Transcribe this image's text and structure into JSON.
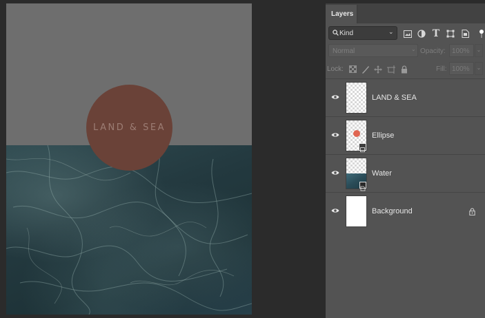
{
  "canvas": {
    "ellipse_text": "LAND & SEA",
    "colors": {
      "top_fill": "#6e6e6e",
      "ellipse_fill": "#6a4238",
      "water": "#23393f"
    }
  },
  "layers_panel": {
    "tab_label": "Layers",
    "filter": {
      "kind_label": "Kind",
      "icons": [
        "image-filter-icon",
        "adjustment-filter-icon",
        "type-filter-icon",
        "shape-filter-icon",
        "smart-object-filter-icon",
        "filter-toggle-icon"
      ]
    },
    "blend_mode": "Normal",
    "opacity_label": "Opacity:",
    "opacity_value": "100%",
    "lock_label": "Lock:",
    "lock_icons": [
      "lock-transparency-icon",
      "lock-pixels-icon",
      "lock-position-icon",
      "lock-artboard-icon",
      "lock-all-icon"
    ],
    "fill_label": "Fill:",
    "fill_value": "100%",
    "layers": [
      {
        "name": "LAND & SEA",
        "thumb": "transparent",
        "visible": true
      },
      {
        "name": "Ellipse",
        "thumb": "shape",
        "visible": true
      },
      {
        "name": "Water",
        "thumb": "smart-object",
        "visible": true
      },
      {
        "name": "Background",
        "thumb": "white",
        "visible": true,
        "locked": true
      }
    ]
  }
}
